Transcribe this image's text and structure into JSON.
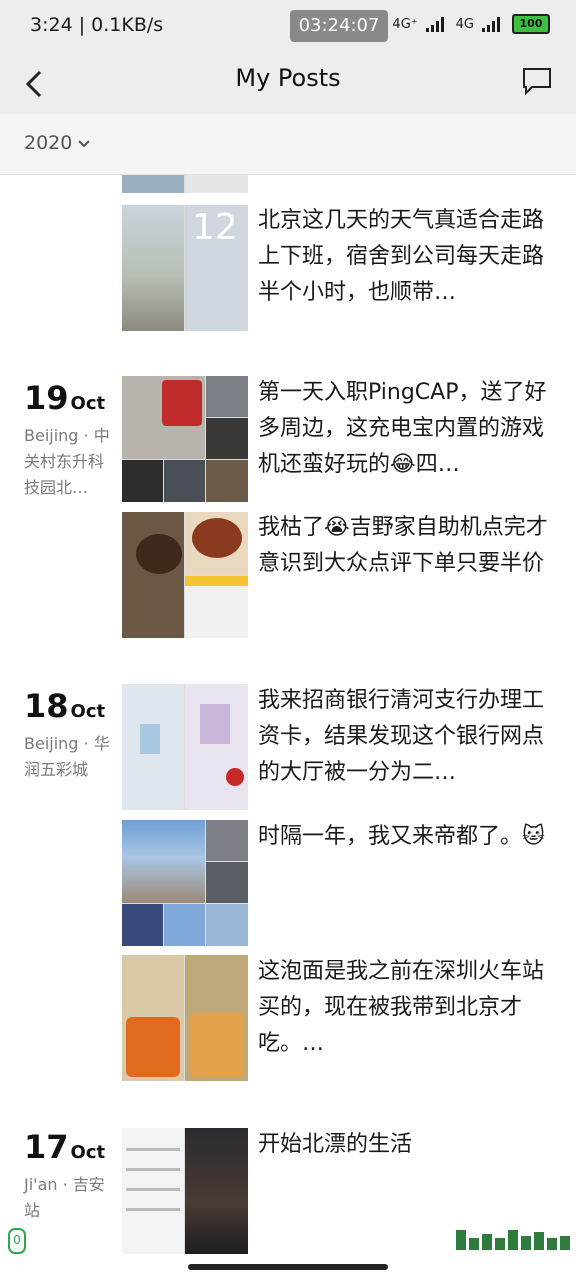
{
  "status_bar": {
    "time": "3:24 | 0.1KB/s",
    "clock": "03:24:07",
    "network_1": "4G⁺",
    "network_2": "4G",
    "battery": "100"
  },
  "nav": {
    "title": "My Posts"
  },
  "year_filter": {
    "year": "2020"
  },
  "entries": [
    {
      "posts": [
        {
          "text": "北京这几天的天气真适合走路上下班，宿舍到公司每天走路半个小时，也顺带…",
          "thumb_label": "12"
        }
      ]
    },
    {
      "day": "19",
      "month": "Oct",
      "location": "Beijing · 中关村东升科技园北…",
      "posts": [
        {
          "text": "第一天入职PingCAP，送了好多周边，这充电宝内置的游戏机还蛮好玩的😂四…"
        },
        {
          "text": "我枯了😭吉野家自助机点完才意识到大众点评下单只要半价"
        }
      ]
    },
    {
      "day": "18",
      "month": "Oct",
      "location": "Beijing · 华润五彩城",
      "posts": [
        {
          "text": "我来招商银行清河支行办理工资卡，结果发现这个银行网点的大厅被一分为二…"
        },
        {
          "text": "时隔一年，我又来帝都了。🐱"
        },
        {
          "text": "这泡面是我之前在深圳火车站买的，现在被我带到北京才吃。…"
        }
      ]
    },
    {
      "day": "17",
      "month": "Oct",
      "location": "Ji'an · 吉安站",
      "posts": [
        {
          "text": "开始北漂的生活"
        }
      ]
    }
  ],
  "overlay": {
    "badge": "0"
  },
  "colors": {
    "accent_green": "#2aa84a",
    "bar_bg": "#ededed"
  }
}
